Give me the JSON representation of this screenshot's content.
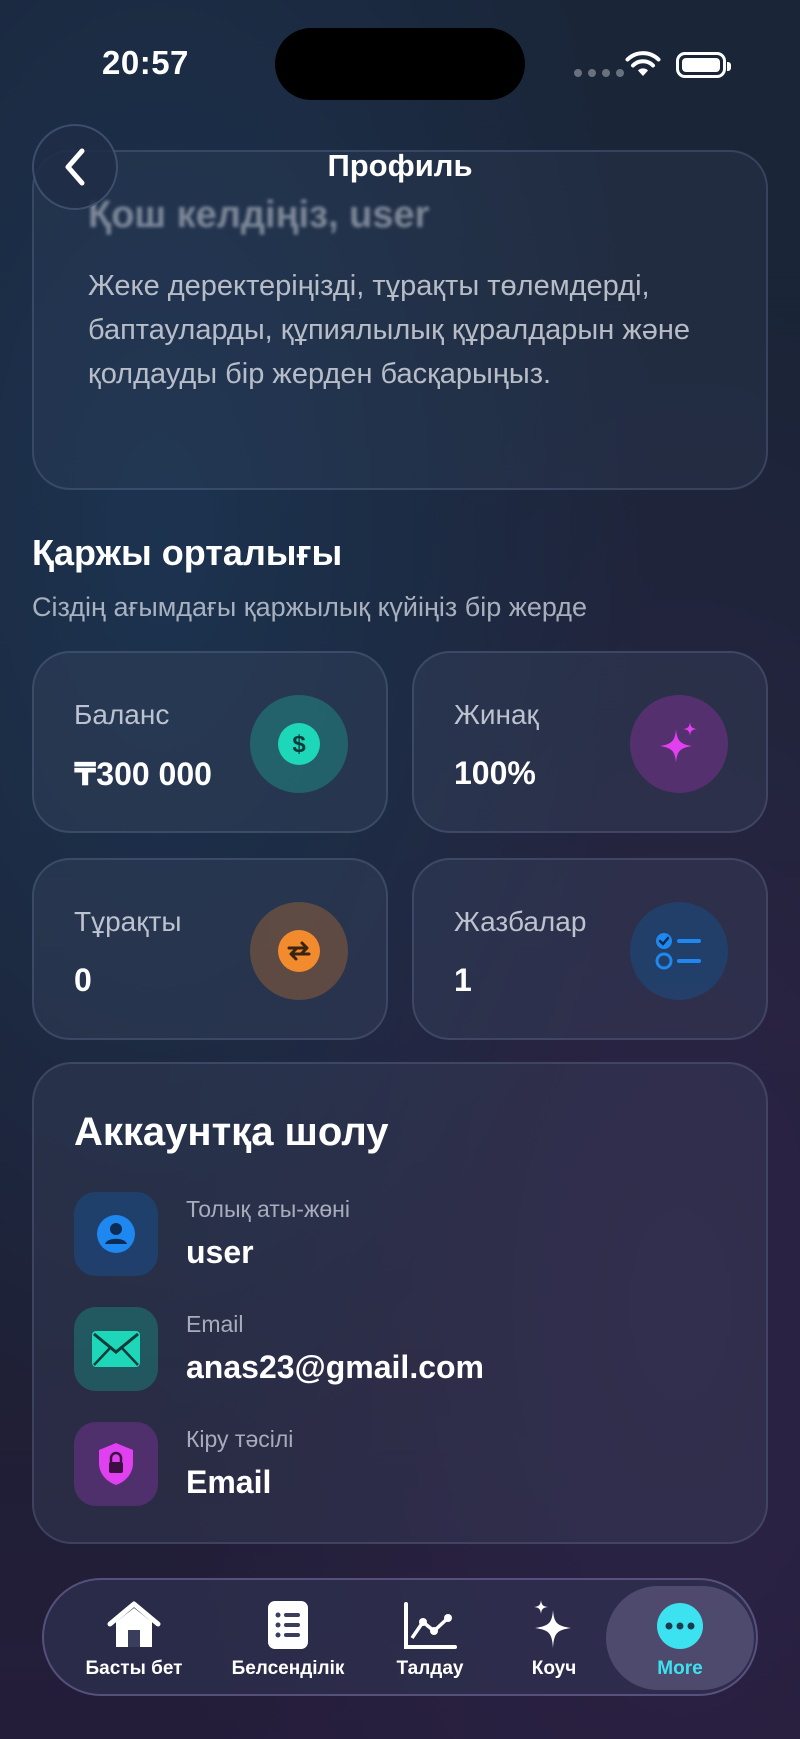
{
  "status_bar": {
    "time": "20:57"
  },
  "header": {
    "title": "Профиль"
  },
  "welcome": {
    "title": "Қош келдіңіз, user",
    "description": "Жеке деректеріңізді, тұрақты төлемдерді, баптауларды, құпиялылық құралдарын және қолдауды бір жерден басқарыңыз."
  },
  "finance": {
    "title": "Қаржы орталығы",
    "subtitle": "Сіздің ағымдағы қаржылық күйіңіз бір жерде",
    "stats": [
      {
        "label": "Баланс",
        "value": "₸300 000",
        "icon": "dollar-icon",
        "color": "#1ed6b8"
      },
      {
        "label": "Жинақ",
        "value": "100%",
        "icon": "sparkle-icon",
        "color": "#d24ce6"
      },
      {
        "label": "Тұрақты",
        "value": "0",
        "icon": "repeat-icon",
        "color": "#f28a2e"
      },
      {
        "label": "Жазбалар",
        "value": "1",
        "icon": "checklist-icon",
        "color": "#1e88f0"
      }
    ]
  },
  "account": {
    "title": "Аккаунтқа шолу",
    "rows": [
      {
        "label": "Толық аты-жөні",
        "value": "user",
        "icon": "person-icon"
      },
      {
        "label": "Email",
        "value": "anas23@gmail.com",
        "icon": "mail-icon"
      },
      {
        "label": "Кіру тәсілі",
        "value": "Email",
        "icon": "lock-shield-icon"
      }
    ]
  },
  "tabbar": {
    "tabs": [
      {
        "label": "Басты бет",
        "icon": "home-icon"
      },
      {
        "label": "Белсенділік",
        "icon": "list-icon"
      },
      {
        "label": "Талдау",
        "icon": "chart-icon"
      },
      {
        "label": "Коуч",
        "icon": "sparkle-icon"
      },
      {
        "label": "More",
        "icon": "more-icon",
        "active": true
      }
    ]
  },
  "colors": {
    "accent": "#3de2f0",
    "background": "#1b2436"
  }
}
